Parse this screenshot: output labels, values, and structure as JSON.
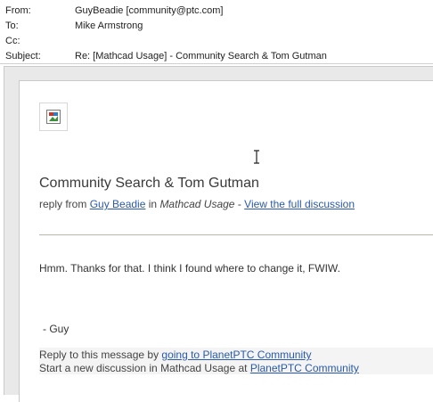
{
  "header": {
    "from_label": "From:",
    "from_value": "GuyBeadie [community@ptc.com]",
    "to_label": "To:",
    "to_value": "Mike Armstrong",
    "cc_label": "Cc:",
    "cc_value": "",
    "subject_label": "Subject:",
    "subject_value": "Re: [Mathcad Usage] - Community Search & Tom Gutman"
  },
  "message": {
    "image_icon": "broken-image-icon",
    "title": "Community Search & Tom Gutman",
    "reply_from_prefix": "reply from",
    "author_link": "Guy Beadie",
    "in_text": "in",
    "community": "Mathcad Usage",
    "separator": "-",
    "view_link": "View the full discussion",
    "body": "Hmm.  Thanks for that.  I think I found where to change it, FWIW.",
    "signature": "- Guy",
    "reply_prefix": "Reply to this message by",
    "reply_link": "going to PlanetPTC Community",
    "start_prefix": "Start a new discussion in Mathcad Usage at",
    "start_link": "PlanetPTC Community"
  },
  "colors": {
    "link": "#2a5aa8",
    "frame": "#e9e9e9",
    "text": "#333333"
  },
  "cursor_icon": "text-ibeam-cursor-icon"
}
